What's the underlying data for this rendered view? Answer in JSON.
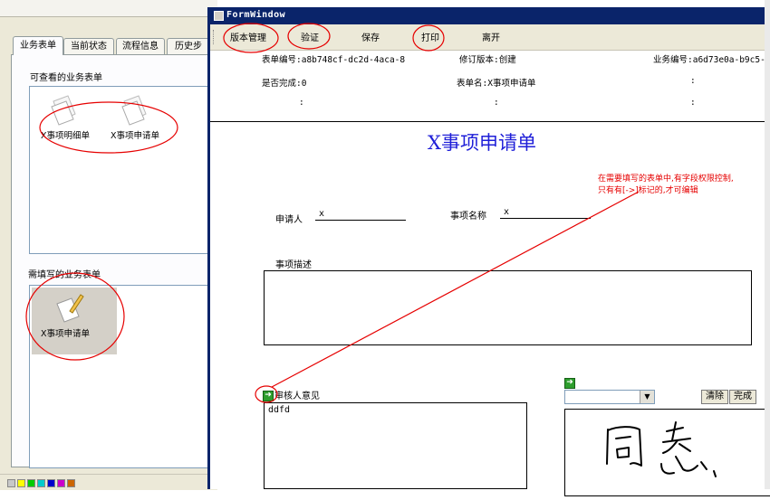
{
  "left_app": {
    "tabs": [
      "业务表单",
      "当前状态",
      "流程信息",
      "历史步"
    ],
    "viewable_group_label": "可查看的业务表单",
    "viewable_items": [
      "X事项明细单",
      "X事项申请单"
    ],
    "fillable_group_label": "需填写的业务表单",
    "fillable_items": [
      "X事项申请单"
    ]
  },
  "form_window": {
    "title": "FormWindow",
    "toolbar": [
      "版本管理",
      "验证",
      "保存",
      "打印",
      "离开"
    ],
    "meta": {
      "form_no": "表单编号:a8b748cf-dc2d-4aca-8",
      "revision": "修订版本:创建",
      "business_no": "业务编号:a6d73e0a-b9c5-",
      "is_complete": "是否完成:0",
      "form_name": "表单名:X事项申请单",
      "colon": ":"
    },
    "form_title": "X事项申请单",
    "fields": {
      "applicant_label": "申请人",
      "applicant_value": "x",
      "item_name_label": "事项名称",
      "item_name_value": "x",
      "description_label": "事项描述",
      "reviewer_label": "审核人意见",
      "reviewer_value": "ddfd"
    },
    "signature": {
      "clear_button": "清除",
      "done_button": "完成"
    },
    "annotation_note": [
      "在需要填写的表单中,有字段权限控制,",
      "只有有[->]标记的,才可编辑"
    ]
  },
  "colors": {
    "title_blue": "#1f1fd8",
    "titlebar": "#0a246a",
    "annotation_red": "#e60000",
    "arrow_green": "#2e9e2e"
  }
}
